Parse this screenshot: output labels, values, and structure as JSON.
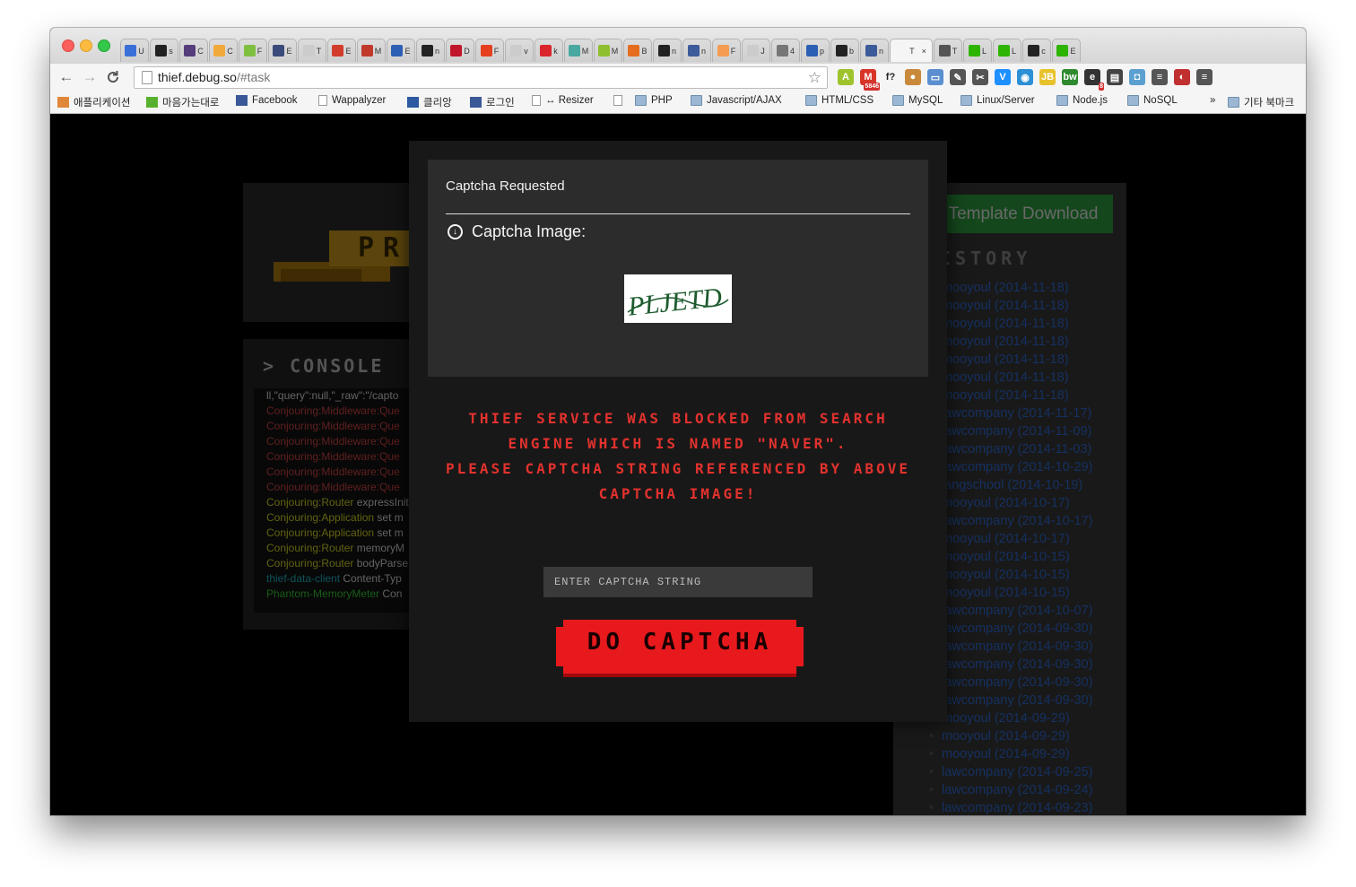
{
  "browser": {
    "tabs": [
      {
        "label": "U",
        "color": "#3a6fd8"
      },
      {
        "label": "s",
        "color": "#222222"
      },
      {
        "label": "C",
        "color": "#563d7c"
      },
      {
        "label": "C",
        "color": "#f2a93b"
      },
      {
        "label": "F",
        "color": "#7fbf3f"
      },
      {
        "label": "E",
        "color": "#3a4a7a"
      },
      {
        "label": "T",
        "color": "#cccccc"
      },
      {
        "label": "E",
        "color": "#d13c2c"
      },
      {
        "label": "M",
        "color": "#c0392b"
      },
      {
        "label": "E",
        "color": "#2c5fb3"
      },
      {
        "label": "n",
        "color": "#222222"
      },
      {
        "label": "D",
        "color": "#c0152a"
      },
      {
        "label": "F",
        "color": "#e53f1f"
      },
      {
        "label": "v",
        "color": "#cccccc"
      },
      {
        "label": "k",
        "color": "#d9252b"
      },
      {
        "label": "M",
        "color": "#49a8a0"
      },
      {
        "label": "M",
        "color": "#8fbf2f"
      },
      {
        "label": "B",
        "color": "#e56d1f"
      },
      {
        "label": "n",
        "color": "#222222"
      },
      {
        "label": "n",
        "color": "#3b5b9a"
      },
      {
        "label": "F",
        "color": "#f39c52"
      },
      {
        "label": "J",
        "color": "#cccccc"
      },
      {
        "label": "4",
        "color": "#777777"
      },
      {
        "label": "p",
        "color": "#2c5fb3"
      },
      {
        "label": "b",
        "color": "#222222"
      },
      {
        "label": "n",
        "color": "#3b5b9a"
      },
      {
        "label": "T",
        "color": "#f5f5f5",
        "active": true,
        "close": "×"
      },
      {
        "label": "T",
        "color": "#555555"
      },
      {
        "label": "L",
        "color": "#2db400"
      },
      {
        "label": "L",
        "color": "#2db400"
      },
      {
        "label": "c",
        "color": "#222222"
      },
      {
        "label": "E",
        "color": "#2db400"
      }
    ],
    "nav": {
      "back": "←",
      "forward": "→",
      "reload": "C"
    },
    "url": {
      "host": "thief.debug.so",
      "path": "/#task"
    },
    "star": "☆",
    "extensions": [
      {
        "icon": "android-icon",
        "glyph": "A",
        "color": "#9fc32d"
      },
      {
        "icon": "gmail-icon",
        "glyph": "M",
        "color": "#d8352a",
        "badge": "5846"
      },
      {
        "icon": "function-icon",
        "glyph": "f?",
        "color": "#f5f5f5"
      },
      {
        "icon": "cookie-icon",
        "glyph": "●",
        "color": "#c8893a"
      },
      {
        "icon": "folder-icon",
        "glyph": "▭",
        "color": "#5b8fcf"
      },
      {
        "icon": "eyedropper-icon",
        "glyph": "✎",
        "color": "#555555"
      },
      {
        "icon": "wrench-icon",
        "glyph": "✂",
        "color": "#555555"
      },
      {
        "icon": "vimium-icon",
        "glyph": "V",
        "color": "#1e90ff"
      },
      {
        "icon": "globe-icon",
        "glyph": "◉",
        "color": "#2d8fd5"
      },
      {
        "icon": "jsonbeautify-icon",
        "glyph": "JB",
        "color": "#e8c22b"
      },
      {
        "icon": "bw-icon",
        "glyph": "bw",
        "color": "#2f8a2f"
      },
      {
        "icon": "e-icon",
        "glyph": "e",
        "color": "#333333",
        "badge": "8"
      },
      {
        "icon": "film-icon",
        "glyph": "▤",
        "color": "#444444"
      },
      {
        "icon": "camera-icon",
        "glyph": "◘",
        "color": "#5ba0d0"
      },
      {
        "icon": "flag-icon",
        "glyph": "≡",
        "color": "#555555"
      },
      {
        "icon": "mask-icon",
        "glyph": "◐",
        "color": "#c03030"
      },
      {
        "icon": "menu-icon",
        "glyph": "≡",
        "color": "#555555"
      }
    ],
    "bookmarks": [
      {
        "label": "애플리케이션",
        "icon": "apps-icon"
      },
      {
        "label": "마음가는대로",
        "icon": "blog-icon"
      },
      {
        "label": "Facebook",
        "icon": "facebook-icon"
      },
      {
        "label": "Wappalyzer",
        "icon": "page-icon"
      },
      {
        "label": "클리앙",
        "icon": "clien-icon"
      },
      {
        "label": "로그인",
        "icon": "facebook-icon"
      },
      {
        "label": "↔ Resizer",
        "icon": "page-icon"
      },
      {
        "label": "",
        "icon": "page-icon"
      },
      {
        "label": "PHP",
        "icon": "folder-icon"
      },
      {
        "label": "Javascript/AJAX",
        "icon": "folder-icon"
      },
      {
        "label": "HTML/CSS",
        "icon": "folder-icon"
      },
      {
        "label": "MySQL",
        "icon": "folder-icon"
      },
      {
        "label": "Linux/Server",
        "icon": "folder-icon"
      },
      {
        "label": "Node.js",
        "icon": "folder-icon"
      },
      {
        "label": "NoSQL",
        "icon": "folder-icon"
      }
    ],
    "bookmarks_overflow": "»",
    "bookmarks_other": "기타 북마크"
  },
  "background": {
    "logo_text": "PR",
    "console": {
      "title": "> CONSOLE",
      "lines": [
        {
          "tag": "",
          "rest": "ll,\"query\":null,\"_raw\":\"/capto",
          "cls": "c-white"
        },
        {
          "tag": "Conjouring:Middleware:Que",
          "rest": "",
          "cls": "c-red"
        },
        {
          "tag": "Conjouring:Middleware:Que",
          "rest": "",
          "cls": "c-red"
        },
        {
          "tag": "Conjouring:Middleware:Que",
          "rest": "",
          "cls": "c-red"
        },
        {
          "tag": "Conjouring:Middleware:Que",
          "rest": "",
          "cls": "c-red"
        },
        {
          "tag": "Conjouring:Middleware:Que",
          "rest": "",
          "cls": "c-red"
        },
        {
          "tag": "Conjouring:Middleware:Que",
          "rest": "",
          "cls": "c-red"
        },
        {
          "tag": "Conjouring:Router",
          "rest": " expressInit",
          "cls": "c-yel"
        },
        {
          "tag": "Conjouring:Application",
          "rest": " set m",
          "cls": "c-yel"
        },
        {
          "tag": "Conjouring:Application",
          "rest": " set m",
          "cls": "c-yel"
        },
        {
          "tag": "Conjouring:Router",
          "rest": " memoryM",
          "cls": "c-yel"
        },
        {
          "tag": "Conjouring:Router",
          "rest": " bodyParse",
          "cls": "c-yel"
        },
        {
          "tag": "thief-data-client",
          "rest": " Content-Typ",
          "cls": "c-cyan"
        },
        {
          "tag": "Phantom-MemoryMeter",
          "rest": " Con",
          "cls": "c-grn"
        }
      ]
    },
    "template_download": "Template Download",
    "history_title": "ISTORY",
    "history": [
      "mooyoul (2014-11-18)",
      "mooyoul (2014-11-18)",
      "mooyoul (2014-11-18)",
      "mooyoul (2014-11-18)",
      "mooyoul (2014-11-18)",
      "mooyoul (2014-11-18)",
      "mooyoul (2014-11-18)",
      "lawcompany (2014-11-17)",
      "lawcompany (2014-11-09)",
      "lawcompany (2014-11-03)",
      "lawcompany (2014-10-29)",
      "langschool (2014-10-19)",
      "mooyoul (2014-10-17)",
      "lawcompany (2014-10-17)",
      "mooyoul (2014-10-17)",
      "mooyoul (2014-10-15)",
      "mooyoul (2014-10-15)",
      "mooyoul (2014-10-15)",
      "lawcompany (2014-10-07)",
      "lawcompany (2014-09-30)",
      "lawcompany (2014-09-30)",
      "lawcompany (2014-09-30)",
      "lawcompany (2014-09-30)",
      "lawcompany (2014-09-30)",
      "mooyoul (2014-09-29)",
      "mooyoul (2014-09-29)",
      "mooyoul (2014-09-29)",
      "lawcompany (2014-09-25)",
      "lawcompany (2014-09-24)",
      "lawcompany (2014-09-23)"
    ]
  },
  "modal": {
    "title": "Captcha Requested",
    "captcha_label": "Captcha Image:",
    "captcha_text": "PLJETD",
    "warning_lines": [
      "THIEF SERVICE WAS BLOCKED FROM SEARCH",
      "ENGINE WHICH IS NAMED \"NAVER\".",
      "PLEASE CAPTCHA STRING REFERENCED BY ABOVE",
      "CAPTCHA IMAGE!"
    ],
    "input_placeholder": "ENTER CAPTCHA STRING",
    "input_value": "",
    "submit_label": "DO CAPTCHA"
  },
  "colors": {
    "warning": "#e2322e",
    "button": "#e8191d",
    "history_link": "#2f6bd5",
    "template_button": "#2e9e3e"
  }
}
